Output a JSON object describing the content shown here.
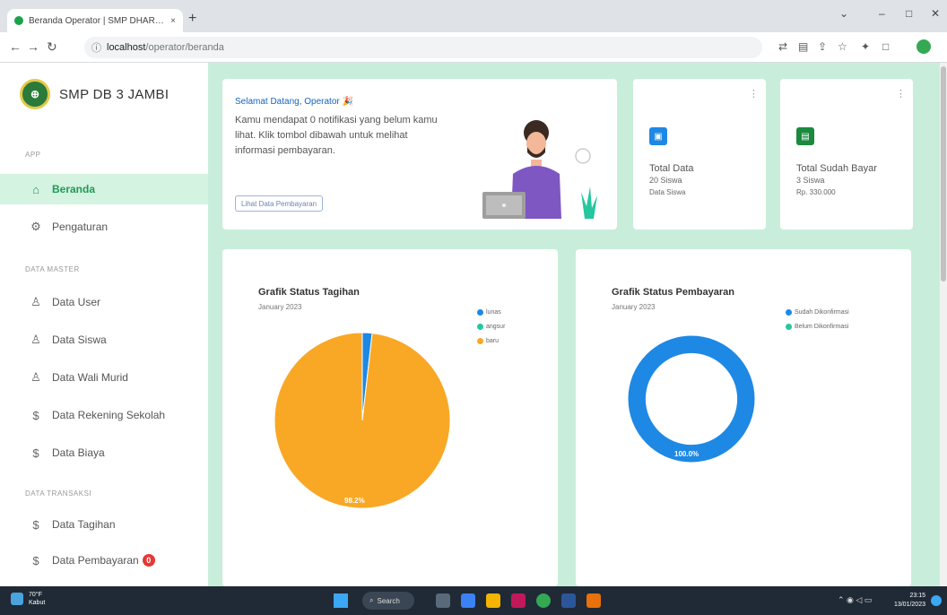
{
  "browser": {
    "tab_title": "Beranda Operator | SMP DHARMA",
    "tab_close": "×",
    "new_tab": "+",
    "url_host": "localhost",
    "url_path": "/operator/beranda",
    "win_min": "–",
    "win_max": "□",
    "win_close": "✕",
    "win_dropdown": "⌄"
  },
  "sidebar": {
    "brand": "SMP DB 3 JAMBI",
    "logo_text": "⊕",
    "section_app": "APP",
    "section_master": "DATA MASTER",
    "section_trans": "DATA TRANSAKSI",
    "items": [
      {
        "label": "Beranda",
        "icon": "⌂"
      },
      {
        "label": "Pengaturan",
        "icon": "⚙"
      },
      {
        "label": "Data User",
        "icon": "♙"
      },
      {
        "label": "Data Siswa",
        "icon": "♙"
      },
      {
        "label": "Data Wali Murid",
        "icon": "♙"
      },
      {
        "label": "Data Rekening Sekolah",
        "icon": "$"
      },
      {
        "label": "Data Biaya",
        "icon": "$"
      },
      {
        "label": "Data Tagihan",
        "icon": "$"
      },
      {
        "label": "Data Pembayaran",
        "icon": "$",
        "badge": "0"
      }
    ]
  },
  "welcome": {
    "title": "Selamat Datang, Operator 🎉",
    "text": "Kamu mendapat 0 notifikasi yang belum kamu lihat. Klik tombol dibawah untuk melihat informasi pembayaran.",
    "button": "Lihat Data Pembayaran"
  },
  "stats": [
    {
      "title": "Total Data",
      "value": "20 Siswa",
      "sub": "Data Siswa",
      "color": "#1e88e5",
      "icon": "▣"
    },
    {
      "title": "Total Sudah Bayar",
      "value": "3 Siswa",
      "sub": "Rp. 330.000",
      "color": "#1b8a3e",
      "icon": "▤"
    }
  ],
  "charts": [
    {
      "title": "Grafik Status Tagihan",
      "subtitle": "January 2023",
      "label": "98.2%",
      "legend": [
        "lunas",
        "angsur",
        "baru"
      ]
    },
    {
      "title": "Grafik Status Pembayaran",
      "subtitle": "January 2023",
      "label": "100.0%",
      "legend": [
        "Sudah Dikonfirmasi",
        "Belum Dikonfirmasi"
      ]
    }
  ],
  "chart_data": [
    {
      "type": "pie",
      "title": "Grafik Status Tagihan",
      "subtitle": "January 2023",
      "categories": [
        "lunas",
        "angsur",
        "baru"
      ],
      "values": [
        1.8,
        0,
        98.2
      ],
      "colors": [
        "#1e88e5",
        "#26c6a0",
        "#f9a825"
      ],
      "legend_position": "right"
    },
    {
      "type": "pie",
      "subtype": "donut",
      "title": "Grafik Status Pembayaran",
      "subtitle": "January 2023",
      "categories": [
        "Sudah Dikonfirmasi",
        "Belum Dikonfirmasi"
      ],
      "values": [
        100,
        0
      ],
      "colors": [
        "#1e88e5",
        "#26c6a0"
      ],
      "legend_position": "right"
    }
  ],
  "taskbar": {
    "weather_temp": "70°F",
    "weather_desc": "Kabut",
    "search": "Search",
    "time": "23:15",
    "date": "13/01/2023"
  }
}
